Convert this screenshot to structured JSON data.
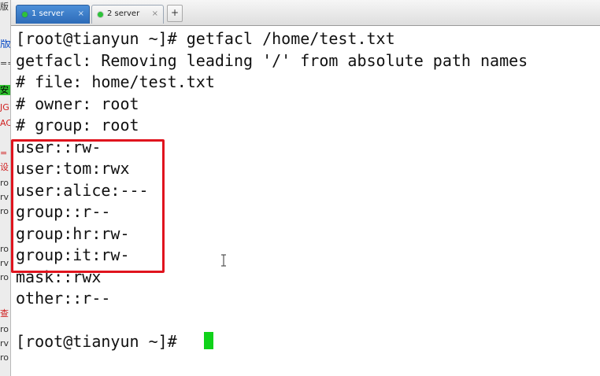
{
  "tabs": [
    {
      "label": "1 server",
      "active": true
    },
    {
      "label": "2 server",
      "active": false
    }
  ],
  "new_tab_label": "+",
  "tab_close_glyph": "×",
  "terminal": {
    "lines": [
      "[root@tianyun ~]# getfacl /home/test.txt",
      "getfacl: Removing leading '/' from absolute path names",
      "# file: home/test.txt",
      "# owner: root",
      "# group: root",
      "user::rw-",
      "user:tom:rwx",
      "user:alice:---",
      "group::r--",
      "group:hr:rw-",
      "group:it:rw-",
      "mask::rwx",
      "other::r--",
      "",
      "[root@tianyun ~]# "
    ]
  },
  "colors": {
    "highlight_box": "#e0141e",
    "cursor": "#10d21a",
    "active_tab": "#3c7cc8",
    "tab_status_dot": "#2ec23a"
  },
  "left_strip": {
    "items": [
      "版",
      "==",
      "安",
      "JG",
      "AC",
      "=",
      "设",
      "ro",
      "rv",
      "ro",
      "ro",
      "rv",
      "ro",
      "查",
      "ro",
      "rv",
      "ro"
    ]
  }
}
